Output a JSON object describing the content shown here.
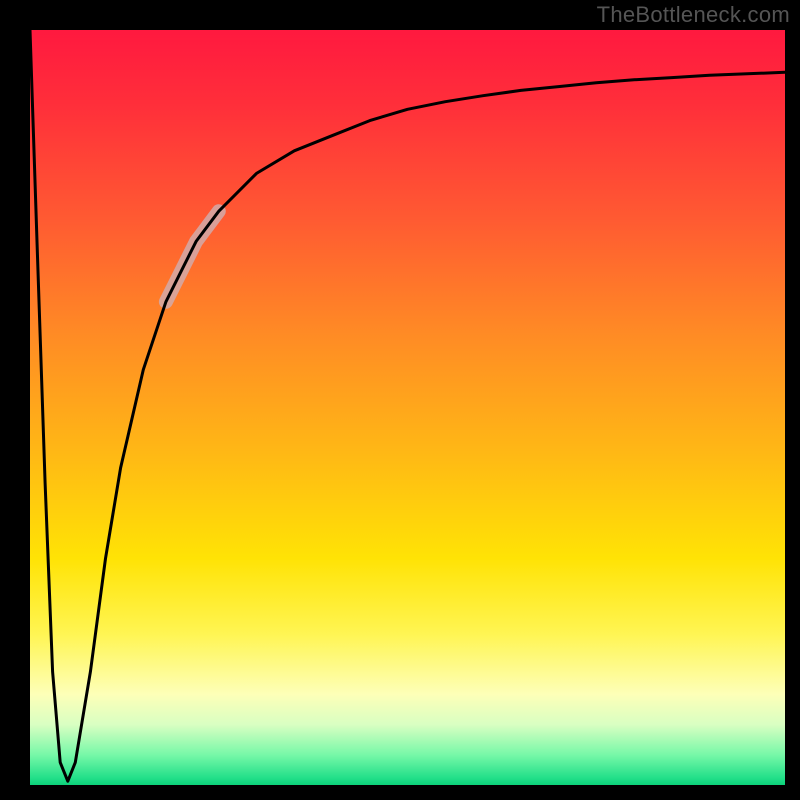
{
  "watermark": "TheBottleneck.com",
  "colors": {
    "frame": "#000000",
    "gradient_stops": [
      "#ff193f",
      "#ff5a32",
      "#ffb516",
      "#ffe305",
      "#fdffb8",
      "#24e08a"
    ],
    "curve": "#000000",
    "highlight": "rgba(210,170,170,0.85)"
  },
  "chart_data": {
    "type": "line",
    "title": "",
    "xlabel": "",
    "ylabel": "",
    "xlim": [
      0,
      100
    ],
    "ylim": [
      0,
      100
    ],
    "grid": false,
    "legend": false,
    "x": [
      0,
      1,
      2,
      3,
      4,
      5,
      6,
      8,
      10,
      12,
      15,
      18,
      20,
      22,
      25,
      30,
      35,
      40,
      45,
      50,
      55,
      60,
      65,
      70,
      75,
      80,
      85,
      90,
      95,
      100
    ],
    "values": [
      100,
      70,
      40,
      15,
      3,
      0.5,
      3,
      15,
      30,
      42,
      55,
      64,
      68,
      72,
      76,
      81,
      84,
      86,
      88,
      89.5,
      90.5,
      91.3,
      92,
      92.5,
      93,
      93.4,
      93.7,
      94,
      94.2,
      94.4
    ],
    "series": [
      {
        "name": "bottleneck-curve",
        "note": "sharp dip near x≈5 to y≈0 then asymptotic rise toward y≈94",
        "color": "#000000"
      }
    ],
    "highlight_segment": {
      "x_start": 18,
      "x_end": 26,
      "note": "thick semi-transparent pinkish overlay on rising part"
    }
  }
}
